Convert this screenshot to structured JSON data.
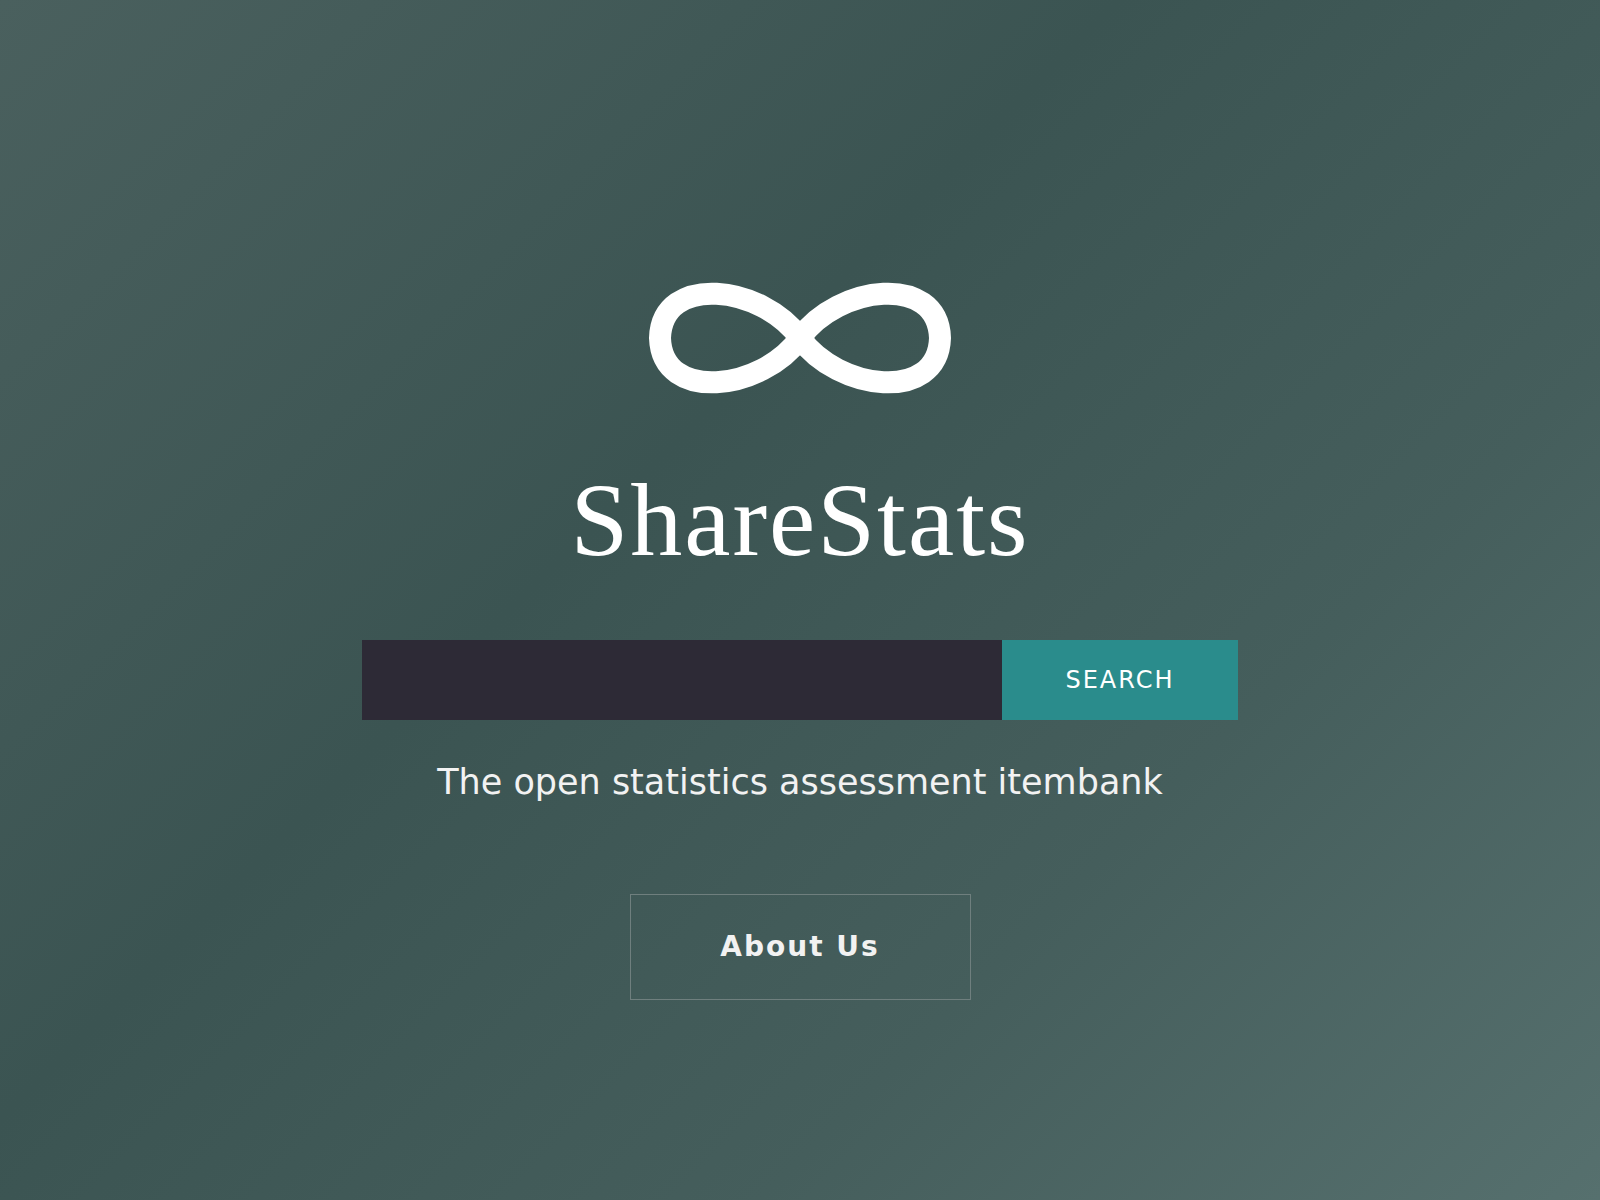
{
  "brand": {
    "name": "ShareStats"
  },
  "search": {
    "button": "SEARCH"
  },
  "tagline": "The open statistics assessment itembank",
  "about_button": "About Us"
}
